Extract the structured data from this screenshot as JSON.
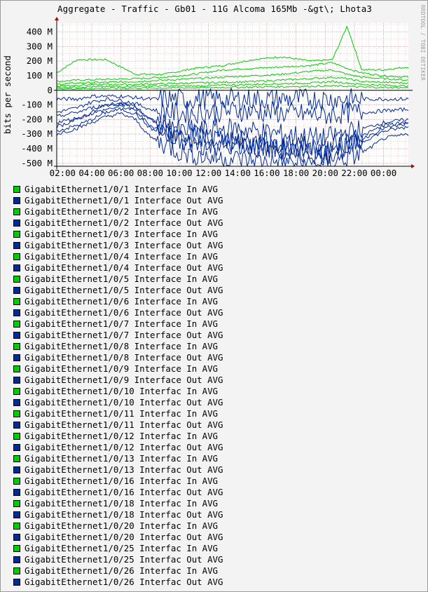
{
  "chart_data": {
    "type": "line",
    "title": "Aggregate - Traffic - Gb01 - 11G Alcoma 165Mb -&gt\\; Lhota3",
    "ylabel": "bits per second",
    "xlabel": "",
    "watermark": "RRDTOOL / TOBI OETIKER",
    "ylim": [
      -520,
      460
    ],
    "y_unit_suffix": "M",
    "y_ticks": [
      {
        "value": 400,
        "label": "400 M"
      },
      {
        "value": 300,
        "label": "300 M"
      },
      {
        "value": 200,
        "label": "200 M"
      },
      {
        "value": 100,
        "label": "100 M"
      },
      {
        "value": 0,
        "label": "0"
      },
      {
        "value": -100,
        "label": "-100 M"
      },
      {
        "value": -200,
        "label": "-200 M"
      },
      {
        "value": -300,
        "label": "-300 M"
      },
      {
        "value": -400,
        "label": "-400 M"
      },
      {
        "value": -500,
        "label": "-500 M"
      }
    ],
    "x_range_hours": [
      1.6,
      25.7
    ],
    "x_ticks": [
      {
        "hour": 2,
        "label": "02:00"
      },
      {
        "hour": 4,
        "label": "04:00"
      },
      {
        "hour": 6,
        "label": "06:00"
      },
      {
        "hour": 8,
        "label": "08:00"
      },
      {
        "hour": 10,
        "label": "10:00"
      },
      {
        "hour": 12,
        "label": "12:00"
      },
      {
        "hour": 14,
        "label": "14:00"
      },
      {
        "hour": 16,
        "label": "16:00"
      },
      {
        "hour": 18,
        "label": "18:00"
      },
      {
        "hour": 20,
        "label": "20:00"
      },
      {
        "hour": 22,
        "label": "22:00"
      },
      {
        "hour": 24,
        "label": "00:00"
      }
    ],
    "grid": true,
    "colors": {
      "in": "#00cc00",
      "out": "#002a97",
      "grid": "#f4a6a6",
      "axis": "#000000",
      "arrow": "#aa0000"
    },
    "in_series_anchor_hours": [
      1.6,
      3.0,
      5.0,
      7.0,
      9.0,
      11.0,
      13.0,
      15.0,
      17.0,
      19.0,
      20.5,
      21.5,
      22.5,
      24.0,
      25.7
    ],
    "in_series": [
      {
        "values": [
          120,
          210,
          210,
          110,
          110,
          150,
          170,
          210,
          230,
          200,
          210,
          440,
          140,
          140,
          160
        ]
      },
      {
        "values": [
          60,
          70,
          75,
          80,
          90,
          110,
          140,
          150,
          160,
          170,
          190,
          150,
          120,
          100,
          90
        ]
      },
      {
        "values": [
          40,
          50,
          55,
          60,
          70,
          80,
          90,
          100,
          110,
          130,
          140,
          110,
          90,
          80,
          70
        ]
      },
      {
        "values": [
          30,
          35,
          40,
          40,
          45,
          50,
          55,
          60,
          70,
          80,
          90,
          80,
          60,
          55,
          50
        ]
      },
      {
        "values": [
          20,
          22,
          25,
          28,
          30,
          30,
          35,
          40,
          45,
          50,
          60,
          50,
          40,
          35,
          30
        ]
      },
      {
        "values": [
          10,
          12,
          14,
          15,
          16,
          18,
          20,
          22,
          25,
          28,
          30,
          28,
          22,
          20,
          18
        ]
      }
    ],
    "out_series_anchor_hours": [
      1.6,
      3.0,
      4.0,
      5.0,
      6.0,
      7.0,
      8.0,
      10.0,
      12.0,
      14.0,
      16.0,
      18.0,
      20.0,
      21.0,
      22.0,
      23.0,
      24.0,
      25.7
    ],
    "out_series": [
      {
        "values": [
          -60,
          -60,
          -40,
          -40,
          -40,
          -50,
          -60,
          -60,
          -60,
          -60,
          -60,
          -60,
          -60,
          -60,
          -60,
          -60,
          -60,
          -60
        ]
      },
      {
        "values": [
          -150,
          -120,
          -80,
          -60,
          -70,
          -90,
          -130,
          -160,
          -150,
          -140,
          -150,
          -160,
          -170,
          -160,
          -150,
          -150,
          -140,
          -130
        ]
      },
      {
        "values": [
          -250,
          -200,
          -150,
          -100,
          -90,
          -110,
          -200,
          -280,
          -270,
          -260,
          -290,
          -310,
          -330,
          -300,
          -280,
          -250,
          -220,
          -200
        ]
      },
      {
        "values": [
          -280,
          -240,
          -200,
          -150,
          -130,
          -160,
          -260,
          -350,
          -380,
          -360,
          -400,
          -420,
          -440,
          -410,
          -380,
          -330,
          -280,
          -250
        ]
      },
      {
        "values": [
          -300,
          -260,
          -220,
          -180,
          -160,
          -200,
          -320,
          -420,
          -460,
          -470,
          -490,
          -500,
          -510,
          -480,
          -450,
          -400,
          -330,
          -300
        ]
      },
      {
        "values": [
          -220,
          -190,
          -160,
          -130,
          -110,
          -140,
          -240,
          -330,
          -360,
          -370,
          -390,
          -410,
          -420,
          -390,
          -360,
          -310,
          -260,
          -230
        ]
      },
      {
        "values": [
          -180,
          -150,
          -120,
          -100,
          -90,
          -120,
          -200,
          -300,
          -320,
          -340,
          -360,
          -380,
          -400,
          -370,
          -340,
          -290,
          -240,
          -220
        ]
      }
    ],
    "legend": [
      {
        "label": "GigabitEthernet1/0/1 Interface In AVG",
        "color": "#00cc00"
      },
      {
        "label": "GigabitEthernet1/0/1 Interface Out AVG",
        "color": "#002a97"
      },
      {
        "label": "GigabitEthernet1/0/2 Interface In AVG",
        "color": "#00cc00"
      },
      {
        "label": "GigabitEthernet1/0/2 Interface Out AVG",
        "color": "#002a97"
      },
      {
        "label": "GigabitEthernet1/0/3 Interface In AVG",
        "color": "#00cc00"
      },
      {
        "label": "GigabitEthernet1/0/3 Interface Out AVG",
        "color": "#002a97"
      },
      {
        "label": "GigabitEthernet1/0/4 Interface In AVG",
        "color": "#00cc00"
      },
      {
        "label": "GigabitEthernet1/0/4 Interface Out AVG",
        "color": "#002a97"
      },
      {
        "label": "GigabitEthernet1/0/5 Interface In AVG",
        "color": "#00cc00"
      },
      {
        "label": "GigabitEthernet1/0/5 Interface Out AVG",
        "color": "#002a97"
      },
      {
        "label": "GigabitEthernet1/0/6 Interface In AVG",
        "color": "#00cc00"
      },
      {
        "label": "GigabitEthernet1/0/6 Interface Out AVG",
        "color": "#002a97"
      },
      {
        "label": "GigabitEthernet1/0/7 Interface In AVG",
        "color": "#00cc00"
      },
      {
        "label": "GigabitEthernet1/0/7 Interface Out AVG",
        "color": "#002a97"
      },
      {
        "label": "GigabitEthernet1/0/8 Interface In AVG",
        "color": "#00cc00"
      },
      {
        "label": "GigabitEthernet1/0/8 Interface Out AVG",
        "color": "#002a97"
      },
      {
        "label": "GigabitEthernet1/0/9 Interface In AVG",
        "color": "#00cc00"
      },
      {
        "label": "GigabitEthernet1/0/9 Interface Out AVG",
        "color": "#002a97"
      },
      {
        "label": "GigabitEthernet1/0/10 Interfac In AVG",
        "color": "#00cc00"
      },
      {
        "label": "GigabitEthernet1/0/10 Interfac Out AVG",
        "color": "#002a97"
      },
      {
        "label": "GigabitEthernet1/0/11 Interfac In AVG",
        "color": "#00cc00"
      },
      {
        "label": "GigabitEthernet1/0/11 Interfac Out AVG",
        "color": "#002a97"
      },
      {
        "label": "GigabitEthernet1/0/12 Interfac In AVG",
        "color": "#00cc00"
      },
      {
        "label": "GigabitEthernet1/0/12 Interfac Out AVG",
        "color": "#002a97"
      },
      {
        "label": "GigabitEthernet1/0/13 Interfac In AVG",
        "color": "#00cc00"
      },
      {
        "label": "GigabitEthernet1/0/13 Interfac Out AVG",
        "color": "#002a97"
      },
      {
        "label": "GigabitEthernet1/0/16 Interfac In AVG",
        "color": "#00cc00"
      },
      {
        "label": "GigabitEthernet1/0/16 Interfac Out AVG",
        "color": "#002a97"
      },
      {
        "label": "GigabitEthernet1/0/18 Interfac In AVG",
        "color": "#00cc00"
      },
      {
        "label": "GigabitEthernet1/0/18 Interfac Out AVG",
        "color": "#002a97"
      },
      {
        "label": "GigabitEthernet1/0/20 Interfac In AVG",
        "color": "#00cc00"
      },
      {
        "label": "GigabitEthernet1/0/20 Interfac Out AVG",
        "color": "#002a97"
      },
      {
        "label": "GigabitEthernet1/0/25 Interfac In AVG",
        "color": "#00cc00"
      },
      {
        "label": "GigabitEthernet1/0/25 Interfac Out AVG",
        "color": "#002a97"
      },
      {
        "label": "GigabitEthernet1/0/26 Interfac In AVG",
        "color": "#00cc00"
      },
      {
        "label": "GigabitEthernet1/0/26 Interfac Out AVG",
        "color": "#002a97"
      }
    ]
  }
}
